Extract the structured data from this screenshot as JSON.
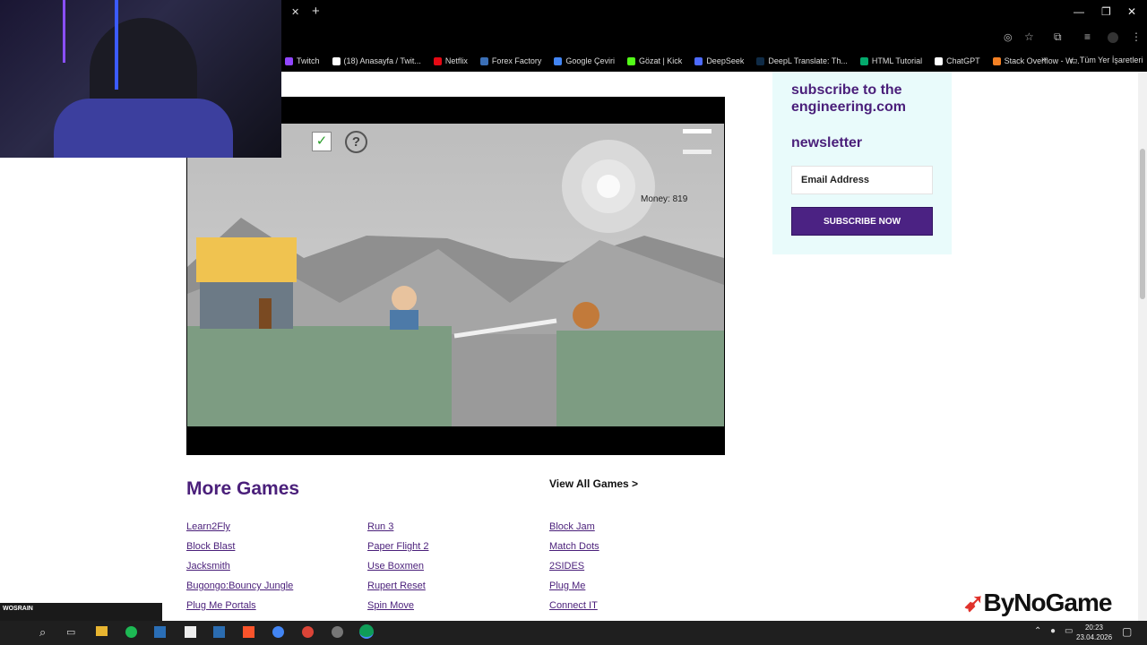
{
  "browser": {
    "tab_close": "✕",
    "tab_new": "+",
    "bookmarks": [
      {
        "label": "Twitch",
        "color": "#9146ff"
      },
      {
        "label": "(18) Anasayfa / Twit...",
        "color": "#ffffff"
      },
      {
        "label": "Netflix",
        "color": "#e50914"
      },
      {
        "label": "Forex Factory",
        "color": "#3b6fb6"
      },
      {
        "label": "Google Çeviri",
        "color": "#4285f4"
      },
      {
        "label": "Gözat | Kick",
        "color": "#53fc18"
      },
      {
        "label": "DeepSeek",
        "color": "#4d6bfe"
      },
      {
        "label": "DeepL Translate: Th...",
        "color": "#0f2b46"
      },
      {
        "label": "HTML Tutorial",
        "color": "#04aa6d"
      },
      {
        "label": "ChatGPT",
        "color": "#ffffff"
      },
      {
        "label": "Stack Overflow - W...",
        "color": "#f48024"
      }
    ],
    "more_bookmarks": "»",
    "all_bookmarks": "Tüm Yer İşaretleri"
  },
  "game": {
    "money_label": "Money: 819"
  },
  "newsletter": {
    "title_line1": "subscribe to the",
    "title_line2": "engineering.com",
    "title_line3": "newsletter",
    "email_placeholder": "Email Address",
    "subscribe_label": "SUBSCRIBE NOW"
  },
  "more_games": {
    "title": "More Games",
    "view_all": "View All Games >",
    "col1": [
      "Learn2Fly",
      "Block Blast",
      "Jacksmith",
      "Bugongo:Bouncy Jungle",
      "Plug Me Portals"
    ],
    "col2": [
      "Run 3",
      "Paper Flight 2",
      "Use Boxmen",
      "Rupert Reset",
      "Spin Move"
    ],
    "col3": [
      "Block Jam",
      "Match Dots",
      "2SIDES",
      "Plug Me",
      "Connect IT"
    ]
  },
  "brand": {
    "logo_text": "ByNoGame"
  },
  "taskbar": {
    "stream_label": "WOSRAIN",
    "time": "20:23",
    "date": "23.04.2026"
  }
}
